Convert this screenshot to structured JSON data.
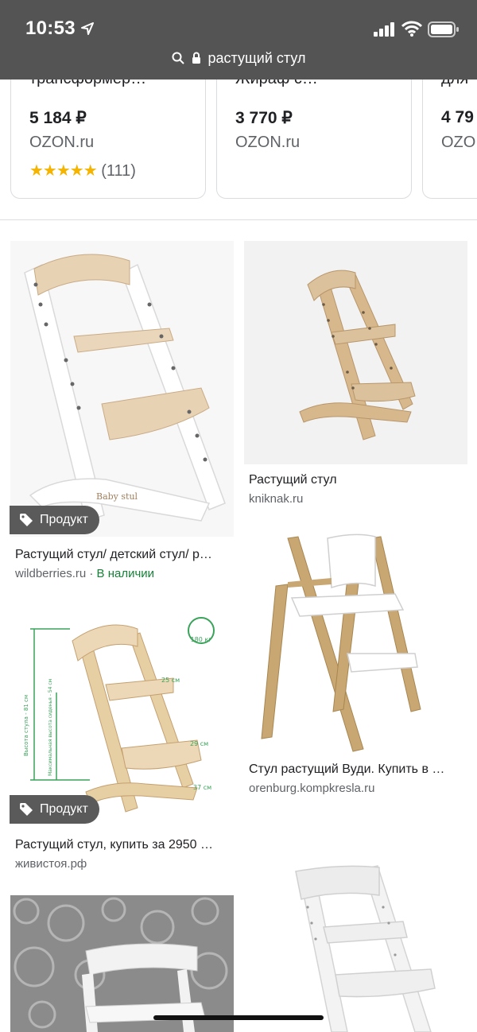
{
  "status": {
    "time": "10:53"
  },
  "url": {
    "query": "растущий стул"
  },
  "carousel": [
    {
      "title": "трансформер…",
      "price": "5 184 ₽",
      "store": "OZON.ru",
      "stars": "★★★★★",
      "reviews": "(111)"
    },
    {
      "title": "Жираф с…",
      "price": "3 770 ₽",
      "store": "OZON.ru"
    },
    {
      "title": "для",
      "price": "4 79",
      "store": "OZO"
    }
  ],
  "results": [
    {
      "caption": "Растущий стул/ детский стул/ р…",
      "source": "wildberries.ru",
      "separator": " · ",
      "stock": "В наличии",
      "badge": "Продукт",
      "logo_text": "Baby stul"
    },
    {
      "caption": "Растущий стул",
      "source": "kniknak.ru"
    },
    {
      "caption": "Растущий стул, купить за 2950 …",
      "source": "живистоя.рф",
      "badge": "Продукт",
      "dims": {
        "weight": "180 кг",
        "d1": "25 см",
        "d2": "29 см",
        "d3": "37 см",
        "h1": "Высота стула - 81 см",
        "h2": "Максимальная высота сиденья - 54 см"
      }
    },
    {
      "caption": "Стул растущий Вуди. Купить в …",
      "source": "orenburg.kompkresla.ru"
    }
  ],
  "colors": {
    "topbar": "#545454",
    "star": "#f5b400",
    "in_stock": "#188038",
    "badge": "#5a5a5a"
  }
}
